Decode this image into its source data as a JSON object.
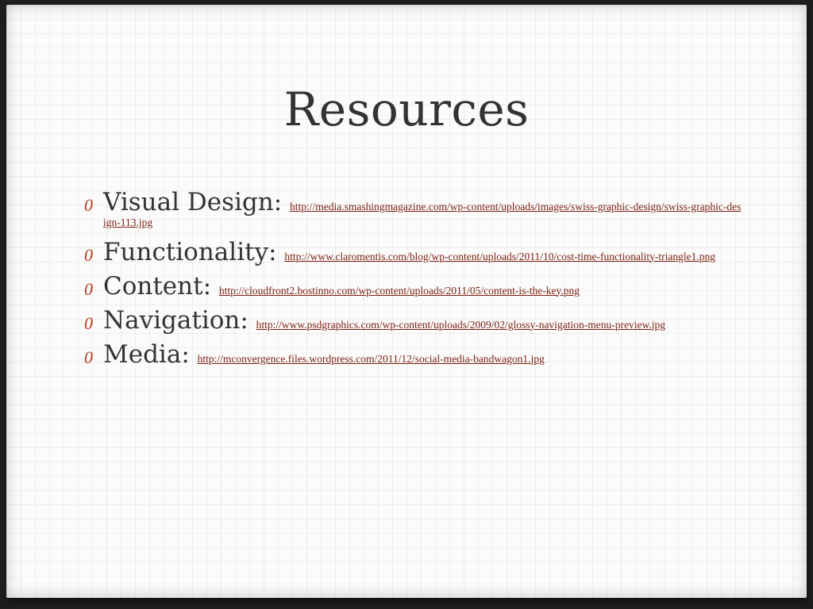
{
  "slide": {
    "title": "Resources",
    "bullet_glyph": "0",
    "items": [
      {
        "label": "Visual Design:",
        "url": "http://media.smashingmagazine.com/wp-content/uploads/images/swiss-graphic-design/swiss-graphic-design-113.jpg"
      },
      {
        "label": "Functionality:",
        "url": "http://www.claromentis.com/blog/wp-content/uploads/2011/10/cost-time-functionality-triangle1.png"
      },
      {
        "label": "Content:",
        "url": "http://cloudfront2.bostinno.com/wp-content/uploads/2011/05/content-is-the-key.png"
      },
      {
        "label": "Navigation:",
        "url": "http://www.psdgraphics.com/wp-content/uploads/2009/02/glossy-navigation-menu-preview.jpg"
      },
      {
        "label": "Media:",
        "url": "http://mconvergence.files.wordpress.com/2011/12/social-media-bandwagon1.jpg"
      }
    ],
    "colors": {
      "bullet": "#b83a1a",
      "link": "#7a1f0e",
      "text": "#333333",
      "background": "#fbfbfb"
    }
  }
}
